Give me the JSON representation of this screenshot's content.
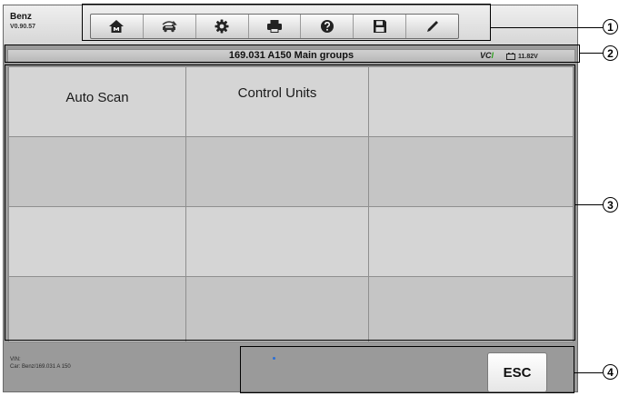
{
  "app": {
    "make": "Benz",
    "version": "V0.90.57"
  },
  "toolbar": {
    "buttons": [
      {
        "name": "home-icon",
        "icon": "home"
      },
      {
        "name": "vehicle-swap-icon",
        "icon": "vehicle-swap"
      },
      {
        "name": "settings-icon",
        "icon": "gear"
      },
      {
        "name": "print-icon",
        "icon": "printer"
      },
      {
        "name": "help-icon",
        "icon": "question"
      },
      {
        "name": "save-icon",
        "icon": "floppy-disk"
      },
      {
        "name": "pen-icon",
        "icon": "pen"
      }
    ]
  },
  "status": {
    "title": "169.031 A150 Main groups",
    "vci_main": "VC",
    "vci_suffix": "I",
    "voltage": "11.82V"
  },
  "grid": {
    "rows": [
      [
        "Auto Scan",
        "Control Units",
        ""
      ],
      [
        "",
        "",
        ""
      ],
      [
        "",
        "",
        ""
      ],
      [
        "",
        "",
        ""
      ]
    ]
  },
  "footer": {
    "vin_label": "VIN:",
    "car_label": "Car: Benz/169.031 A 150",
    "esc_label": "ESC"
  },
  "callouts": [
    "1",
    "2",
    "3",
    "4"
  ],
  "colors": {
    "vci_accent": "#2fa020",
    "background": "#9a9a9a",
    "indicator_dot": "#2a6fd6"
  }
}
